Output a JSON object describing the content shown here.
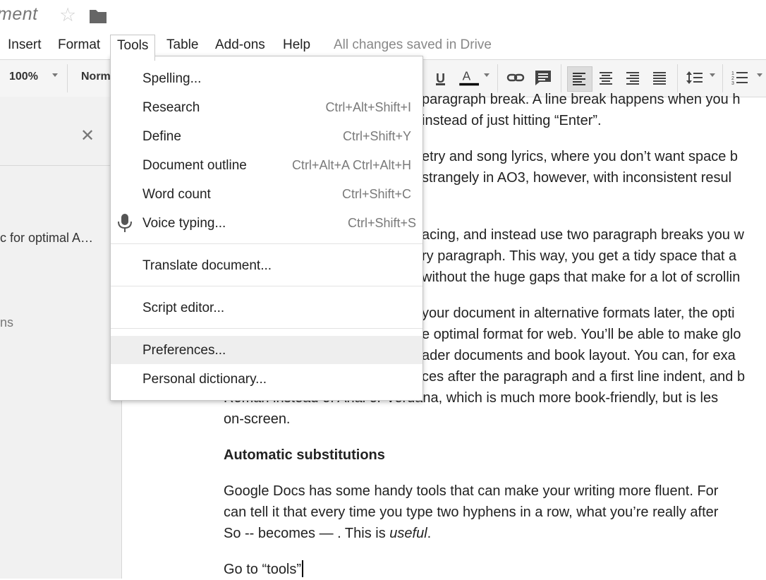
{
  "title": {
    "doc": "ment"
  },
  "menubar": {
    "items": [
      "Insert",
      "Format",
      "Tools",
      "Table",
      "Add-ons",
      "Help"
    ],
    "active": "Tools",
    "status": "All changes saved in Drive"
  },
  "toolbar": {
    "zoom": "100%",
    "style": "Norm",
    "text_color": "#000000"
  },
  "sidebar": {
    "item1": "c for optimal A…",
    "item2": "ns"
  },
  "document": {
    "lines": [
      "paragraph break. A line break happens when you h",
      "instead of just hitting “Enter”.",
      "etry and song lyrics, where you don’t want space b",
      "strangely in AO3, however, with inconsistent resul",
      "acing, and instead use two paragraph breaks you w",
      "ry paragraph. This way, you get a tidy space that a",
      "without the huge gaps that make for a lot of scrollin",
      "your document in alternative formats later, the opti",
      "e optimal format for web. You’ll be able to make glo",
      "ader documents and book layout.  You can, for exa",
      "ces after the paragraph and a first line indent, and b",
      "Roman instead of Arial or Verdana, which is much more book-friendly, but is les",
      "on-screen."
    ],
    "heading": "Automatic substitutions",
    "para2": [
      "Google Docs has some handy tools that can make your writing more fluent. For",
      "can tell it that every time you type two hyphens in a row, what you’re really after"
    ],
    "para2_line3_start": "So -- becomes — . This is ",
    "para2_line3_em": "useful",
    "para2_line3_end": ".",
    "last_line": "Go to “tools”"
  },
  "tools_menu": {
    "items": [
      {
        "label": "Spelling...",
        "shortcut": ""
      },
      {
        "label": "Research",
        "shortcut": "Ctrl+Alt+Shift+I"
      },
      {
        "label": "Define",
        "shortcut": "Ctrl+Shift+Y"
      },
      {
        "label": "Document outline",
        "shortcut": "Ctrl+Alt+A Ctrl+Alt+H"
      },
      {
        "label": "Word count",
        "shortcut": "Ctrl+Shift+C"
      },
      {
        "label": "Voice typing...",
        "shortcut": "Ctrl+Shift+S"
      },
      {
        "label": "Translate document...",
        "shortcut": ""
      },
      {
        "label": "Script editor...",
        "shortcut": ""
      },
      {
        "label": "Preferences...",
        "shortcut": ""
      },
      {
        "label": "Personal dictionary...",
        "shortcut": ""
      }
    ],
    "hovered": "Preferences..."
  }
}
